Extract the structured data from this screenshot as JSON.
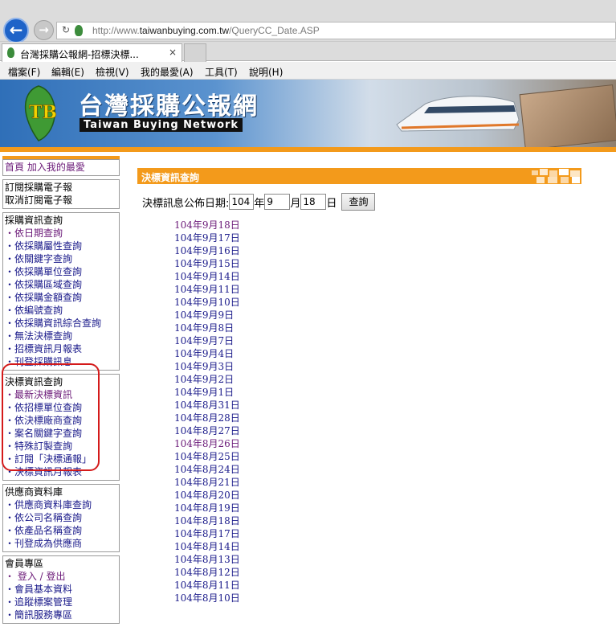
{
  "browser": {
    "url_prefix": "http://www.",
    "url_domain": "taiwanbuying.com.tw",
    "url_path": "/QueryCC_Date.ASP",
    "tab_title": "台灣採購公報網-招標決標...",
    "tab_close": "×",
    "back_glyph": "←",
    "forward_glyph": "→",
    "refresh_glyph": "↻"
  },
  "menubar": {
    "items": [
      "檔案(F)",
      "編輯(E)",
      "檢視(V)",
      "我的最愛(A)",
      "工具(T)",
      "說明(H)"
    ]
  },
  "banner": {
    "title_zh": "台灣採購公報網",
    "title_en": "Taiwan Buying Network",
    "logo_text": "TB"
  },
  "sidebar": {
    "top": [
      "首頁 加入我的最愛"
    ],
    "subscribe": [
      "訂閱採購電子報",
      "取消訂閱電子報"
    ],
    "procurement": {
      "heading": "採購資訊查詢",
      "items": [
        "・依日期查詢",
        "・依採購屬性查詢",
        "・依關鍵字查詢",
        "・依採購單位查詢",
        "・依採購區域查詢",
        "・依採購金額查詢",
        "・依編號查詢",
        "・依採購資訊綜合查詢",
        "・無法決標查詢",
        "・招標資訊月報表",
        "・刊登採購訊息"
      ]
    },
    "award": {
      "heading": "決標資訊查詢",
      "items": [
        "・最新決標資訊",
        "・依招標單位查詢",
        "・依決標廠商查詢",
        "・案名關鍵字查詢",
        "・特殊訂製查詢",
        "・訂閱「決標通報」",
        "・決標資訊月報表"
      ]
    },
    "supplier": {
      "heading": "供應商資料庫",
      "items": [
        "・供應商資料庫查詢",
        "・依公司名稱查詢",
        "・依產品名稱查詢",
        "・刊登成為供應商"
      ]
    },
    "member": {
      "heading": "會員專區",
      "items": [
        "・ 登入 / 登出",
        "・會員基本資料",
        "・追蹤標案管理",
        "・簡訊服務專區"
      ]
    }
  },
  "main": {
    "header_title": "決標資訊查詢",
    "query_label": "決標訊息公佈日期:",
    "year_value": "104",
    "year_unit": "年",
    "month_value": "9",
    "month_unit": "月",
    "day_value": "18",
    "day_unit": "日",
    "query_button": "查詢",
    "dates": [
      "104年9月18日",
      "104年9月17日",
      "104年9月16日",
      "104年9月15日",
      "104年9月14日",
      "104年9月11日",
      "104年9月10日",
      "104年9月9日",
      "104年9月8日",
      "104年9月7日",
      "104年9月4日",
      "104年9月3日",
      "104年9月2日",
      "104年9月1日",
      "104年8月31日",
      "104年8月28日",
      "104年8月27日",
      "104年8月26日",
      "104年8月25日",
      "104年8月24日",
      "104年8月21日",
      "104年8月20日",
      "104年8月19日",
      "104年8月18日",
      "104年8月17日",
      "104年8月14日",
      "104年8月13日",
      "104年8月12日",
      "104年8月11日",
      "104年8月10日"
    ],
    "visited_dates": [
      "104年9月18日",
      "104年8月26日"
    ]
  },
  "colors": {
    "accent_orange": "#f39a1b",
    "link_blue": "#1a1a8a",
    "visited_purple": "#6b1a78",
    "highlight_red": "#d41a1a"
  }
}
